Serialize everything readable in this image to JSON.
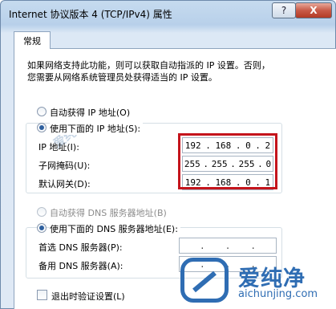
{
  "window": {
    "title": "Internet 协议版本 4 (TCP/IPv4) 属性",
    "help_label": "?",
    "close_label": "X"
  },
  "tabs": [
    {
      "label": "常规"
    }
  ],
  "description": [
    "如果网络支持此功能，则可以获取自动指派的 IP 设置。否则，",
    "您需要从网络系统管理员处获得适当的 IP 设置。"
  ],
  "ip_section": {
    "auto_label": "自动获得 IP 地址(O)",
    "manual_label": "使用下面的 IP 地址(S):",
    "ip_label": "IP 地址(I):",
    "ip_value": [
      "192",
      "168",
      "0",
      "2"
    ],
    "mask_label": "子网掩码(U):",
    "mask_value": [
      "255",
      "255",
      "255",
      "0"
    ],
    "gateway_label": "默认网关(D):",
    "gateway_value": [
      "192",
      "168",
      "0",
      "1"
    ],
    "selected": "manual"
  },
  "dns_section": {
    "auto_label": "自动获得 DNS 服务器地址(B)",
    "manual_label": "使用下面的 DNS 服务器地址(E):",
    "preferred_label": "首选 DNS 服务器(P):",
    "alternate_label": "备用 DNS 服务器(A):",
    "selected": "manual"
  },
  "validate_label": "退出时验证设置(L)",
  "highlight_color": "#c4141c",
  "watermark": {
    "text": "爱纯净",
    "url": "aichunjing.com",
    "faint": "爱纯净"
  }
}
